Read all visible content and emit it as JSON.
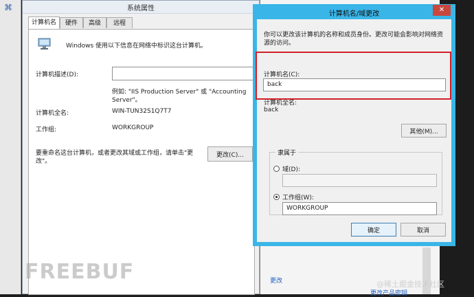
{
  "system_props": {
    "title": "系统属性",
    "tabs": [
      "计算机名",
      "硬件",
      "高级",
      "远程"
    ],
    "intro": "Windows 使用以下信息在网络中标识这台计算机。",
    "desc_label": "计算机描述(D):",
    "desc_value": "",
    "example_line1": "例如: \"IIS Production Server\" 或 \"Accounting",
    "example_line2": "Server\"。",
    "fullname_label": "计算机全名:",
    "fullname_value": "WIN-TUN32S1Q7T7",
    "workgroup_label": "工作组:",
    "workgroup_value": "WORKGROUP",
    "rename_line1": "要重命名这台计算机，或者更改其域或工作组，请单击\"更",
    "rename_line2": "改\"。",
    "change_button": "更改(C)..."
  },
  "background_window": {
    "link1": "更改",
    "link2": "更改产品密钥"
  },
  "dialog": {
    "title": "计算机名/域更改",
    "close_glyph": "✕",
    "intro_line1": "你可以更改该计算机的名称和成员身份。更改可能会影响对网络资",
    "intro_line2": "源的访问。",
    "computer_name_label": "计算机名(C):",
    "computer_name_value": "back",
    "full_name_label": "计算机全名:",
    "full_name_value": "back",
    "other_button": "其他(M)...",
    "member_of": "隶属于",
    "domain_label": "域(D):",
    "domain_value": "",
    "workgroup_label": "工作组(W):",
    "workgroup_value": "WORKGROUP",
    "ok_button": "确定",
    "cancel_button": "取消"
  },
  "watermarks": {
    "left": "FREEBUF",
    "right": "@稀土掘金技术社区"
  },
  "colors": {
    "dialog_frame": "#3ab5e8",
    "highlight": "#d0202a",
    "close_button": "#c9473d"
  }
}
